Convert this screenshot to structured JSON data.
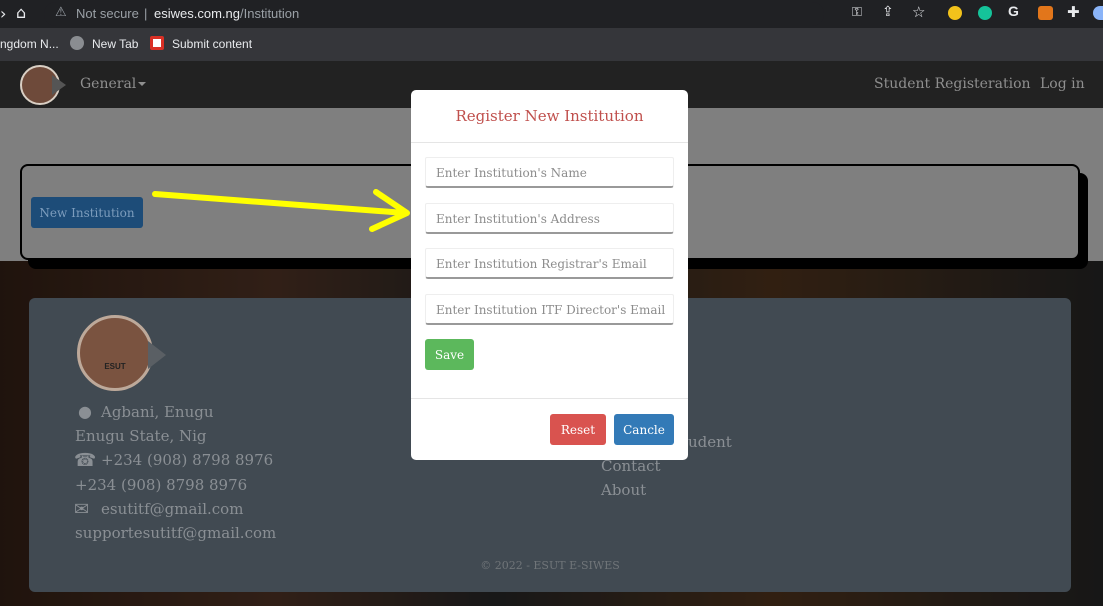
{
  "browser": {
    "security_label": "Not secure",
    "url_host": "esiwes.com.ng",
    "url_path": "/Institution",
    "bookmarks": [
      {
        "label": "ngdom N..."
      },
      {
        "label": "New Tab"
      },
      {
        "label": "Submit content"
      }
    ]
  },
  "navbar": {
    "menu_general": "General",
    "link_student_registration": "Student Registeration",
    "link_login": "Log in"
  },
  "card": {
    "new_institution_button": "New Institution"
  },
  "modal": {
    "title": "Register New Institution",
    "fields": {
      "name_placeholder": "Enter Institution's Name",
      "address_placeholder": "Enter Institution's Address",
      "registrar_email_placeholder": "Enter Institution Registrar's Email",
      "itf_director_email_placeholder": "Enter Institution ITF Director's Email"
    },
    "save_label": "Save",
    "reset_label": "Reset",
    "cancel_label": "Cancle"
  },
  "footer": {
    "logo_text": "ESUT",
    "address_line1": "Agbani, Enugu",
    "address_line2": "Enugu State, Nig",
    "phone1": "+234 (908) 8798 8976",
    "phone2": "+234 (908) 8798 8976",
    "email1": "esutitf@gmail.com",
    "email2": "supportesutitf@gmail.com",
    "link_student_partial": "udent",
    "link_contact": "Contact",
    "link_about": "About",
    "copyright": "© 2022 - ESUT E-SIWES"
  }
}
